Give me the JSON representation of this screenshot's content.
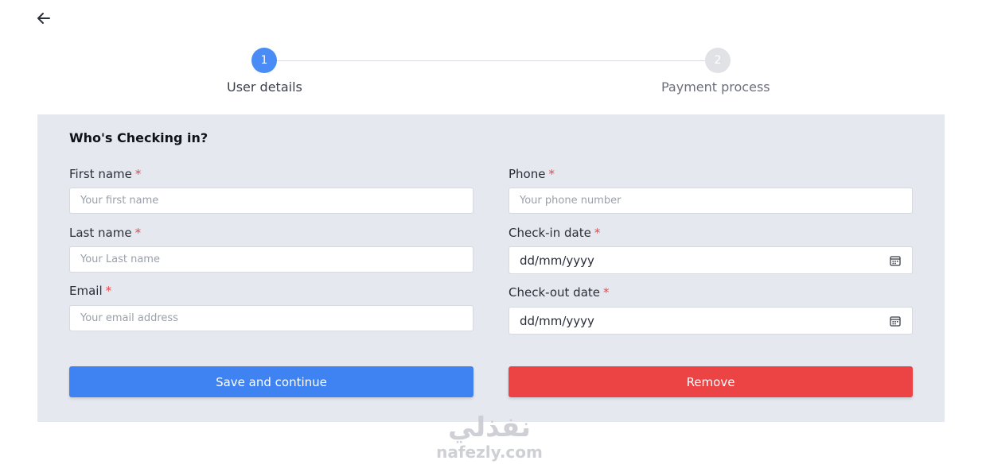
{
  "nav": {
    "back_icon": "arrow-left-icon"
  },
  "stepper": {
    "steps": [
      {
        "number": "1",
        "label": "User details",
        "state": "active"
      },
      {
        "number": "2",
        "label": "Payment process",
        "state": "inactive"
      }
    ]
  },
  "form": {
    "title": "Who's Checking in?",
    "required_mark": "*",
    "fields": {
      "first_name": {
        "label": "First name",
        "placeholder": "Your first name",
        "value": ""
      },
      "last_name": {
        "label": "Last name",
        "placeholder": "Your Last name",
        "value": ""
      },
      "email": {
        "label": "Email",
        "placeholder": "Your email address",
        "value": ""
      },
      "phone": {
        "label": "Phone",
        "placeholder": "Your phone number",
        "value": ""
      },
      "check_in": {
        "label": "Check-in date",
        "value": "dd/mm/yyyy",
        "icon": "calendar-icon"
      },
      "check_out": {
        "label": "Check-out date",
        "value": "dd/mm/yyyy",
        "icon": "calendar-icon"
      }
    },
    "buttons": {
      "save": "Save and continue",
      "remove": "Remove"
    }
  },
  "watermark": {
    "arabic": "نفذلي",
    "latin": "nafezly.com"
  },
  "colors": {
    "primary": "#3f83f2",
    "danger": "#ec4444",
    "step_active": "#4a8cf6",
    "step_inactive": "#e0e2e6",
    "panel_bg": "#e5e8ef",
    "required": "#e5484d"
  }
}
